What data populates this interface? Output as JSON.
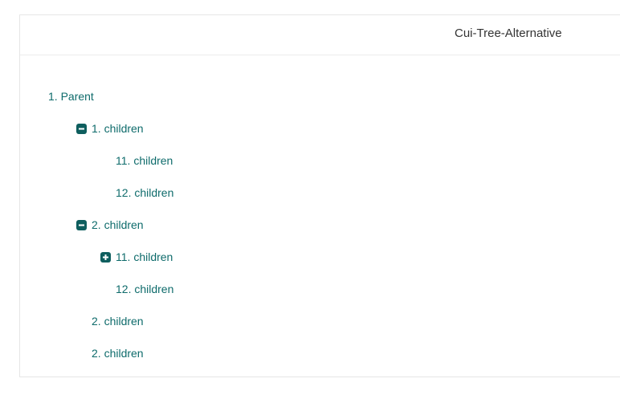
{
  "header": {
    "title": "Cui-Tree-Alternative"
  },
  "tree": {
    "nodes": [
      {
        "label": "1. Parent",
        "toggle": "none",
        "toggle_icon": ""
      },
      {
        "label": "1. children",
        "toggle": "expanded",
        "toggle_icon": "minus-square-icon"
      },
      {
        "label": "11. children",
        "toggle": "none",
        "toggle_icon": ""
      },
      {
        "label": "12. children",
        "toggle": "none",
        "toggle_icon": ""
      },
      {
        "label": "2. children",
        "toggle": "expanded",
        "toggle_icon": "minus-square-icon"
      },
      {
        "label": "11. children",
        "toggle": "collapsed",
        "toggle_icon": "plus-square-icon"
      },
      {
        "label": "12. children",
        "toggle": "none",
        "toggle_icon": ""
      },
      {
        "label": "2. children",
        "toggle": "none",
        "toggle_icon": ""
      },
      {
        "label": "2. children",
        "toggle": "none",
        "toggle_icon": ""
      }
    ]
  },
  "colors": {
    "link": "#0e6b6b",
    "toggle_bg": "#0e5e5e",
    "border": "#e6e6e6"
  }
}
